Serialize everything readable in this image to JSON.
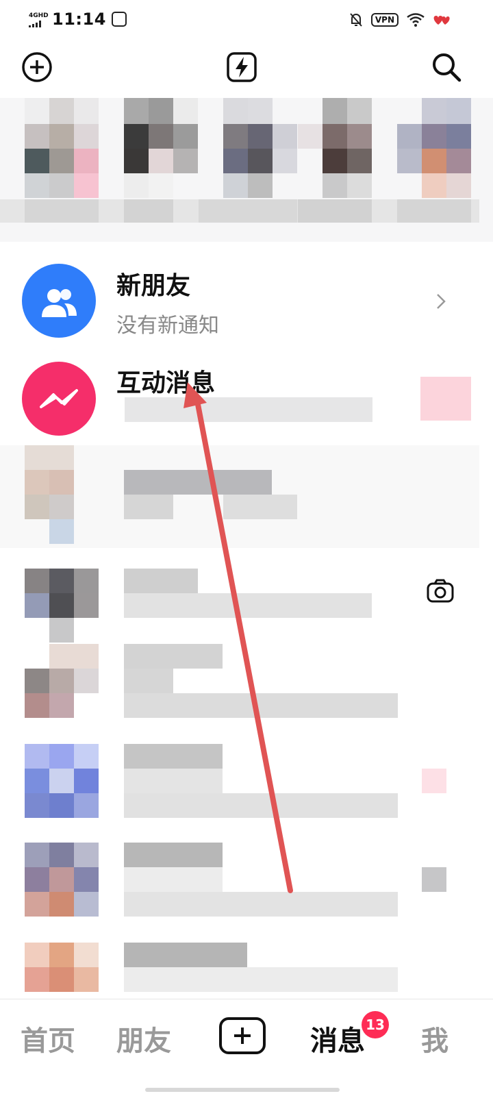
{
  "status_bar": {
    "network": "4GHD",
    "time": "11:14",
    "vpn": "VPN"
  },
  "top_bar": {
    "add_icon": "plus-circle-icon",
    "flash_icon": "lightning-icon",
    "search_icon": "search-icon"
  },
  "list": {
    "new_friends": {
      "title": "新朋友",
      "subtitle": "没有新通知"
    },
    "interactive": {
      "title": "互动消息"
    }
  },
  "bottom_nav": {
    "items": [
      {
        "label": "首页"
      },
      {
        "label": "朋友"
      },
      {
        "label": "消息",
        "badge": "13"
      },
      {
        "label": "我"
      }
    ]
  },
  "colors": {
    "accent": "#fe2c55",
    "blue_avatar": "#2f7dfa",
    "pink_avatar": "#f52e6a",
    "arrow": "#e05454"
  }
}
